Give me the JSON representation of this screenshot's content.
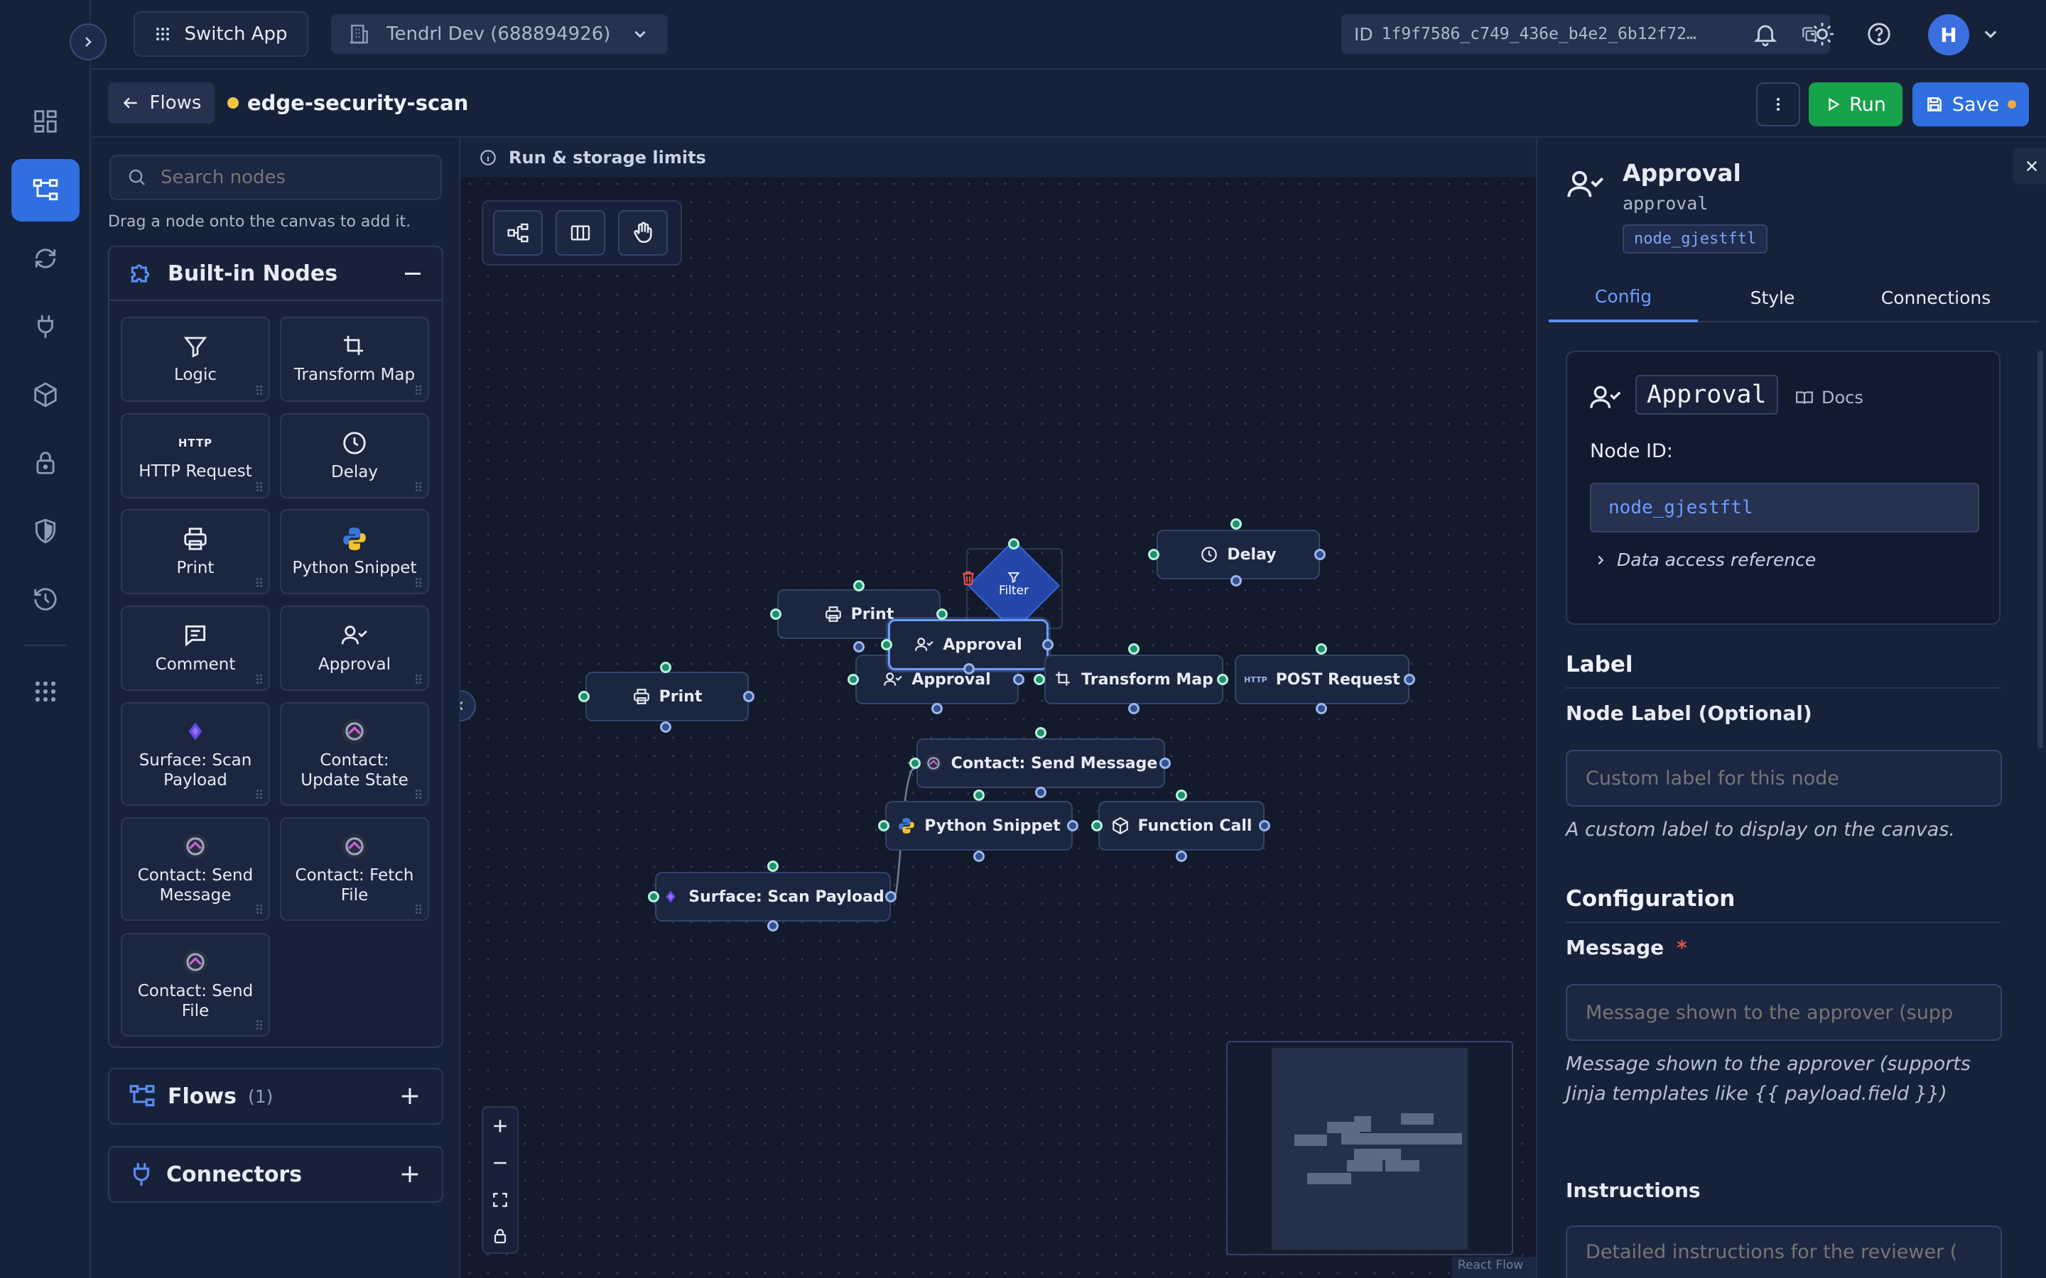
{
  "topbar": {
    "switch_app": "Switch App",
    "org_name": "Tendrl Dev (688894926)",
    "id_label": "ID",
    "id_value": "1f9f7586_c749_436e_b4e2_6b12f72…",
    "avatar_initial": "H"
  },
  "subbar": {
    "back_label": "Flows",
    "flow_name": "edge-security-scan",
    "run_label": "Run",
    "save_label": "Save",
    "status_color": "#f5c542"
  },
  "left_panel": {
    "search_placeholder": "Search nodes",
    "hint": "Drag a node onto the canvas to add it.",
    "builtin_title": "Built-in Nodes",
    "nodes": [
      {
        "label": "Logic",
        "icon": "filter-icon"
      },
      {
        "label": "Transform Map",
        "icon": "transform-icon"
      },
      {
        "label": "HTTP Request",
        "icon": "http-icon"
      },
      {
        "label": "Delay",
        "icon": "clock-icon"
      },
      {
        "label": "Print",
        "icon": "printer-icon"
      },
      {
        "label": "Python Snippet",
        "icon": "python-icon"
      },
      {
        "label": "Comment",
        "icon": "comment-icon"
      },
      {
        "label": "Approval",
        "icon": "user-check-icon"
      },
      {
        "label": "Surface: Scan Payload",
        "icon": "surface-icon"
      },
      {
        "label": "Contact: Update State",
        "icon": "contact-icon"
      },
      {
        "label": "Contact: Send Message",
        "icon": "contact-icon"
      },
      {
        "label": "Contact: Fetch File",
        "icon": "contact-icon"
      },
      {
        "label": "Contact: Send File",
        "icon": "contact-icon"
      }
    ],
    "http_badge": "HTTP",
    "flows_title": "Flows",
    "flows_count": "(1)",
    "connectors_title": "Connectors"
  },
  "canvas": {
    "banner": "Run & storage limits",
    "nodes": {
      "delay": "Delay",
      "filter": "Filter",
      "print_top": "Print",
      "approval_selected": "Approval",
      "approval_2": "Approval",
      "transform_map": "Transform Map",
      "post_request": "POST Request",
      "print_left": "Print",
      "contact_send": "Contact: Send Message",
      "python_snippet": "Python Snippet",
      "function_call": "Function Call",
      "surface_scan": "Surface: Scan Payload"
    },
    "post_badge": "HTTP",
    "attribution": "React Flow"
  },
  "right_panel": {
    "title": "Approval",
    "subtitle": "approval",
    "node_id_chip": "node_gjestftl",
    "tabs": [
      "Config",
      "Style",
      "Connections"
    ],
    "active_tab": "Config",
    "card_title": "Approval",
    "docs": "Docs",
    "node_id_label": "Node ID:",
    "node_id_value": "node_gjestftl",
    "data_access": "Data access reference",
    "label_section": "Label",
    "node_label_title": "Node Label (Optional)",
    "node_label_placeholder": "Custom label for this node",
    "node_label_help": "A custom label to display on the canvas.",
    "config_section": "Configuration",
    "message_label": "Message",
    "required_mark": "*",
    "message_placeholder": "Message shown to the approver (supp",
    "message_help_1": "Message shown to the approver (supports",
    "message_help_2": "Jinja templates like {{ payload.field }})",
    "instructions_label": "Instructions",
    "instructions_placeholder": "Detailed instructions for the reviewer ("
  },
  "colors": {
    "accent": "#3b6fe0",
    "run_green": "#16a34a",
    "handle": "#1f8f6d"
  }
}
